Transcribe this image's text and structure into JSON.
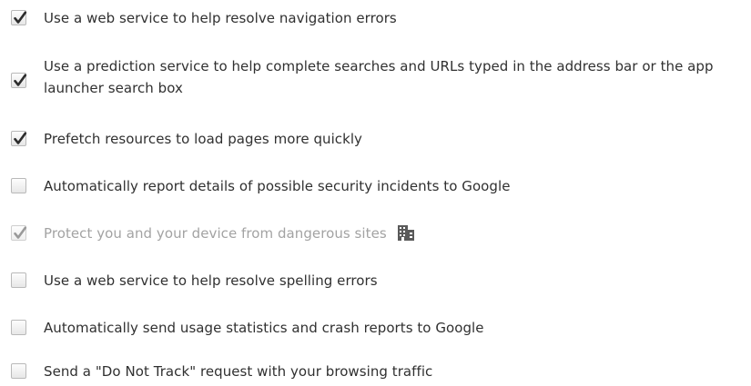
{
  "settings": {
    "options": [
      {
        "label": "Use a web service to help resolve navigation errors",
        "checked": true,
        "disabled": false
      },
      {
        "label": "Use a prediction service to help complete searches and URLs typed in the address bar or the app launcher search box",
        "checked": true,
        "disabled": false
      },
      {
        "label": "Prefetch resources to load pages more quickly",
        "checked": true,
        "disabled": false
      },
      {
        "label": "Automatically report details of possible security incidents to Google",
        "checked": false,
        "disabled": false
      },
      {
        "label": "Protect you and your device from dangerous sites",
        "checked": true,
        "disabled": true,
        "icon": "enterprise-policy-building-icon"
      },
      {
        "label": "Use a web service to help resolve spelling errors",
        "checked": false,
        "disabled": false
      },
      {
        "label": "Automatically send usage statistics and crash reports to Google",
        "checked": false,
        "disabled": false
      },
      {
        "label": "Send a \"Do Not Track\" request with your browsing traffic",
        "checked": false,
        "disabled": false
      }
    ]
  },
  "colors": {
    "text": "#303030",
    "disabled_text": "#a3a3a3",
    "checkmark": "#2d2d2d",
    "disabled_checkmark": "#9a9a9a",
    "checkbox_border": "#b9b9b9"
  }
}
